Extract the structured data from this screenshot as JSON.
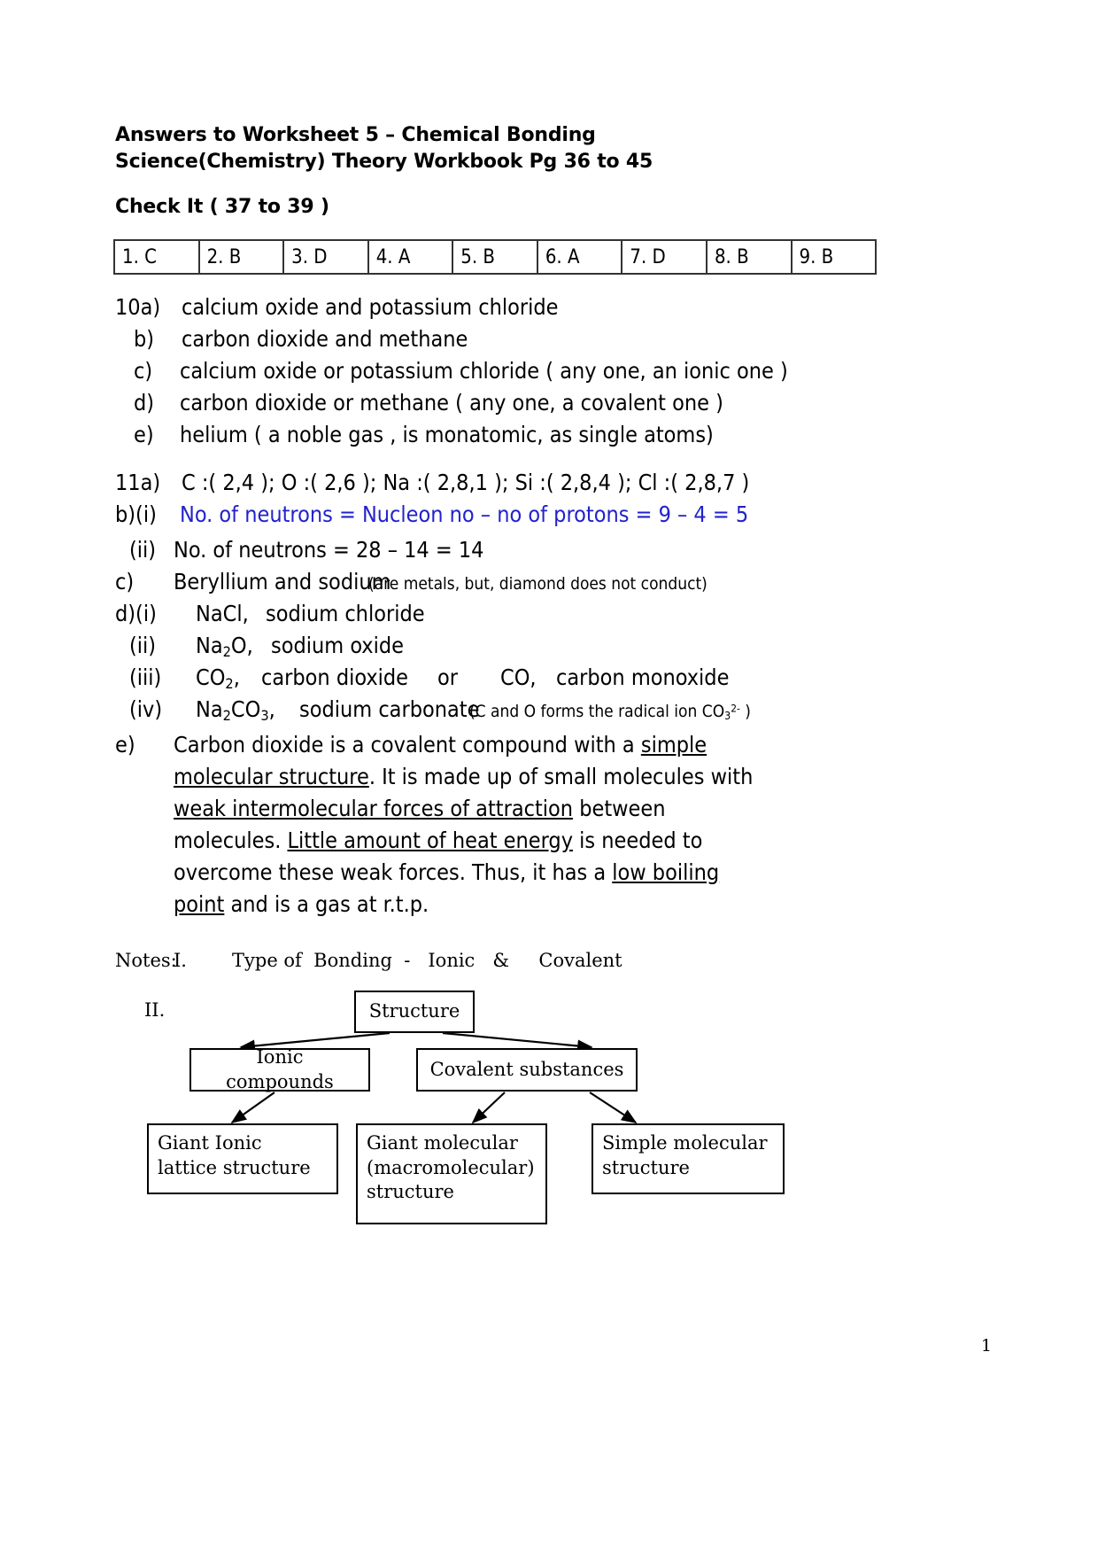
{
  "header": {
    "title_line1": "Answers to Worksheet 5 – Chemical Bonding",
    "title_line2": "Science(Chemistry) Theory Workbook Pg 36 to 45",
    "section_label": "Check It ( 37 to 39 )"
  },
  "answer_table": {
    "cells": [
      "1. C",
      "2. B",
      "3. D",
      "4. A",
      "5. B",
      "6. A",
      "7. D",
      "8. B",
      "9. B"
    ]
  },
  "q10": {
    "a": {
      "marker": "10a)",
      "text": "calcium oxide and potassium chloride"
    },
    "b": {
      "marker": "b)",
      "text": "carbon dioxide and methane"
    },
    "c": {
      "marker": "c)",
      "text": "calcium oxide or potassium chloride ( any one, an ionic one )"
    },
    "d": {
      "marker": "d)",
      "text": "carbon dioxide or methane  ( any one, a covalent one )"
    },
    "e": {
      "marker": "e)",
      "text": "helium    ( a noble gas , is monatomic, as single atoms)"
    }
  },
  "q11": {
    "a": {
      "marker": "11a)",
      "text": "C :( 2,4 );  O :( 2,6 );   Na :( 2,8,1 );   Si :( 2,8,4 );   Cl :( 2,8,7 )"
    },
    "b_i": {
      "marker": "b)(i)",
      "text": "No. of neutrons = Nucleon no – no of protons = 9 – 4 = 5",
      "color": "#2222cc"
    },
    "b_ii": {
      "marker": "(ii)",
      "text": "No. of neutrons = 28 – 14 = 14"
    },
    "c": {
      "marker": "c)",
      "text": "Beryllium and sodium",
      "note": "(are metals, but, diamond does not conduct)"
    },
    "d_i": {
      "marker": "d)(i)",
      "formula": "NaCl,",
      "name": "sodium chloride"
    },
    "d_ii": {
      "marker": "(ii)",
      "formula_pre": "Na",
      "formula_sub": "2",
      "formula_post": "O,",
      "name": "sodium oxide"
    },
    "d_iii": {
      "marker": "(iii)",
      "formula_pre": "CO",
      "formula_sub": "2",
      "formula_post": ",",
      "name": "carbon dioxide",
      "alt_join": "or",
      "alt_formula": "CO,",
      "alt_name": "carbon monoxide"
    },
    "d_iv": {
      "marker": "(iv)",
      "formula_pre": "Na",
      "formula_sub1": "2",
      "formula_mid": "CO",
      "formula_sub2": "3",
      "formula_post": ",",
      "name": "sodium carbonate",
      "note_pre": "(C and O forms the radical ion CO",
      "note_sub": "3",
      "note_sup": "2-",
      "note_post": " )"
    },
    "e": {
      "marker": "e)",
      "line1_pre": "Carbon dioxide is a covalent compound with a ",
      "line1_underline": "simple",
      "line2_underline": "molecular structure",
      "line2_post": ".  It is made up of small molecules with",
      "line3_underline": "weak intermolecular forces of attraction",
      "line3_post": " between",
      "line4_pre": "molecules.  ",
      "line4_underline": "Little amount of heat energy",
      "line4_post": " is needed to",
      "line5_pre": "overcome these weak forces.  Thus, it has a ",
      "line5_underline": "low boiling",
      "line6_underline": "point",
      "line6_post": " and is a gas at r.t.p."
    }
  },
  "notes": {
    "label": "Notes:",
    "item1_num": "I.",
    "item1_text": "Type of  Bonding  -   Ionic   &     Covalent",
    "item2_num": "II."
  },
  "flowchart": {
    "root": "Structure",
    "left": "Ionic compounds",
    "right": "Covalent substances",
    "leaf1_line1": "Giant Ionic",
    "leaf1_line2": "lattice structure",
    "leaf2_line1": "Giant molecular",
    "leaf2_line2": "(macromolecular)",
    "leaf2_line3": "structure",
    "leaf3_line1": "Simple molecular",
    "leaf3_line2": "structure"
  },
  "footer": {
    "page_number": "1"
  }
}
